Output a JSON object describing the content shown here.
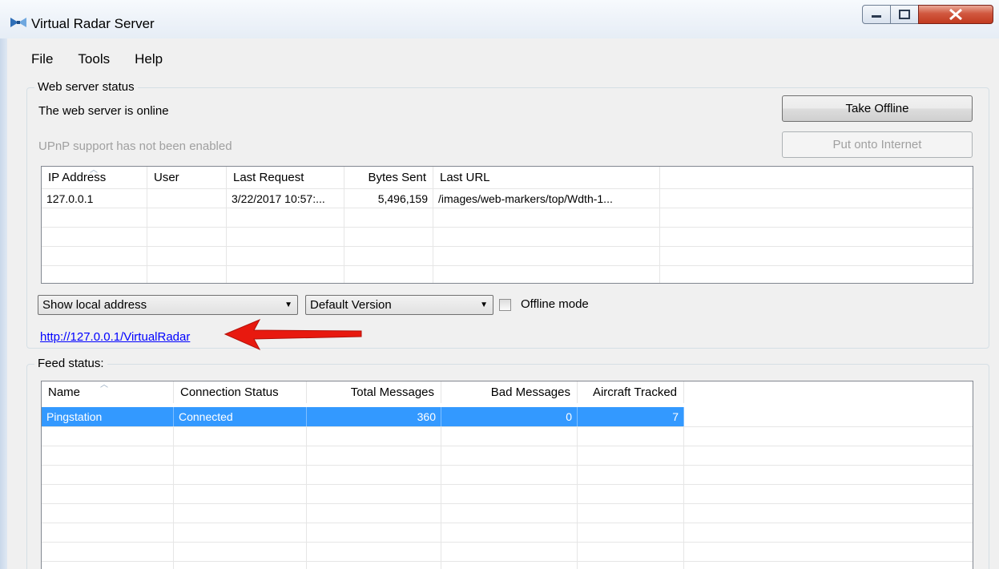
{
  "window": {
    "title": "Virtual Radar Server"
  },
  "menu": [
    "File",
    "Tools",
    "Help"
  ],
  "web_status": {
    "group_label": "Web server status",
    "status_text": "The web server is online",
    "upnp_text": "UPnP support has not been enabled",
    "take_offline_label": "Take Offline",
    "put_online_label": "Put onto Internet",
    "columns": [
      "IP Address",
      "User",
      "Last Request",
      "Bytes Sent",
      "Last URL"
    ],
    "rows": [
      [
        "127.0.0.1",
        "",
        "3/22/2017 10:57:...",
        "5,496,159",
        "/images/web-markers/top/Wdth-1..."
      ]
    ]
  },
  "controls": {
    "address_select": "Show local address",
    "version_select": "Default Version",
    "offline_label": "Offline mode",
    "offline_checked": false,
    "link": "http://127.0.0.1/VirtualRadar"
  },
  "feed_status": {
    "group_label": "Feed status:",
    "columns": [
      "Name",
      "Connection Status",
      "Total Messages",
      "Bad Messages",
      "Aircraft Tracked"
    ],
    "rows": [
      [
        "Pingstation",
        "Connected",
        "360",
        "0",
        "7"
      ]
    ]
  },
  "icons": {
    "app": "radar-icon",
    "minimize": "minimize-icon",
    "maximize": "maximize-icon",
    "close": "close-icon",
    "dropdown": "chevron-down-icon",
    "annotation": "red-arrow-icon"
  },
  "colors": {
    "selection": "#3399ff",
    "link": "#0000ff",
    "arrow": "#e8190f"
  }
}
